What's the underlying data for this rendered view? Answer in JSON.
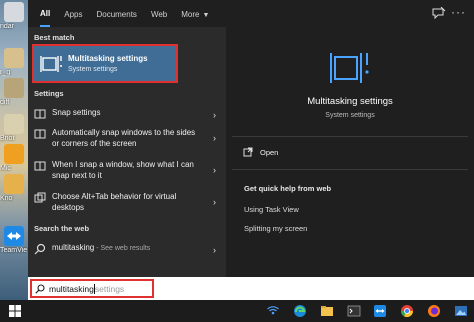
{
  "desktop": {
    "icons": [
      {
        "label": "ndar",
        "color": "#d6d9dd"
      },
      {
        "label": "r_g",
        "color": "#d8c08c"
      },
      {
        "label": "diff",
        "color": "#b7a579"
      },
      {
        "label": "Bnot",
        "color": "#d9d0b0"
      },
      {
        "label": "Mic",
        "color": "#f0a020"
      },
      {
        "label": "Kno",
        "color": "#e6b14a"
      },
      {
        "label": "TeamVie",
        "color": "#1e8ae6"
      }
    ]
  },
  "tabs": {
    "all": "All",
    "apps": "Apps",
    "documents": "Documents",
    "web": "Web",
    "more": "More"
  },
  "best_match": {
    "heading": "Best match",
    "title": "Multitasking settings",
    "subtitle": "System settings"
  },
  "settings": {
    "heading": "Settings",
    "items": [
      {
        "label": "Snap settings"
      },
      {
        "label": "Automatically snap windows to the sides or corners of the screen"
      },
      {
        "label": "When I snap a window, show what I can snap next to it"
      },
      {
        "label": "Choose Alt+Tab behavior for virtual desktops"
      }
    ]
  },
  "web": {
    "heading": "Search the web",
    "query": "multitasking",
    "suffix": " - See web results"
  },
  "preview": {
    "title": "Multitasking settings",
    "subtitle": "System settings",
    "open": "Open",
    "help_heading": "Get quick help from web",
    "links": [
      "Using Task View",
      "Splitting my screen"
    ]
  },
  "search": {
    "typed": "multitasking",
    "ghost": " settings"
  },
  "colors": {
    "accent": "#3f6d95",
    "highlight_border": "#e03030",
    "icon_blue": "#4aa3ff"
  }
}
